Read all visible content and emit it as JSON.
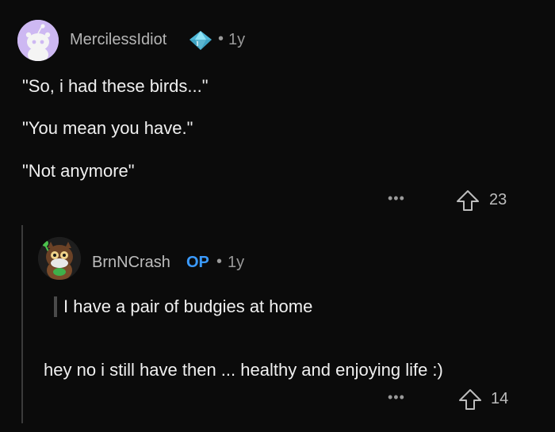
{
  "comment": {
    "username": "MercilessIdiot",
    "separator": "•",
    "age": "1y",
    "badge_icon": "diamond-award-icon",
    "lines": [
      "\"So, i had these birds...\"",
      "\"You mean you have.\"",
      "\"Not anymore\""
    ],
    "more_label": "•••",
    "vote_icon": "upvote-arrow-icon",
    "upvotes": "23"
  },
  "reply": {
    "username": "BrnNCrash",
    "op_label": "OP",
    "separator": "•",
    "age": "1y",
    "quote": "I have a pair of budgies at home",
    "body": "hey no i still have then ... healthy and enjoying life :)",
    "more_label": "•••",
    "vote_icon": "upvote-arrow-icon",
    "upvotes": "14"
  },
  "colors": {
    "background": "#0b0b0b",
    "op_blue": "#3b9bff",
    "avatar_lavender": "#cdb8f2"
  }
}
